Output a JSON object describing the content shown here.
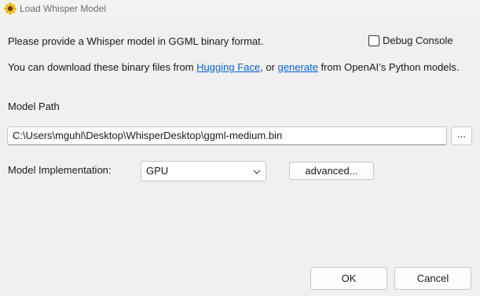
{
  "window": {
    "title": "Load Whisper Model",
    "icon": "sunflower-icon"
  },
  "intro_text": "Please provide a Whisper model in GGML binary format.",
  "debug_console": {
    "label": "Debug Console",
    "checked": false
  },
  "download_text": {
    "prefix": "You can download these binary files from ",
    "link1": "Hugging Face",
    "middle": ", or ",
    "link2": "generate",
    "suffix": " from OpenAI’s Python models."
  },
  "model_path": {
    "label": "Model Path",
    "value": "C:\\Users\\mguhl\\Desktop\\WhisperDesktop\\ggml-medium.bin",
    "browse_label": "..."
  },
  "implementation": {
    "label": "Model Implementation:",
    "selected": "GPU",
    "advanced_label": "advanced..."
  },
  "buttons": {
    "ok": "OK",
    "cancel": "Cancel"
  },
  "colors": {
    "link": "#0b62c7",
    "background": "#f0f0f0"
  }
}
